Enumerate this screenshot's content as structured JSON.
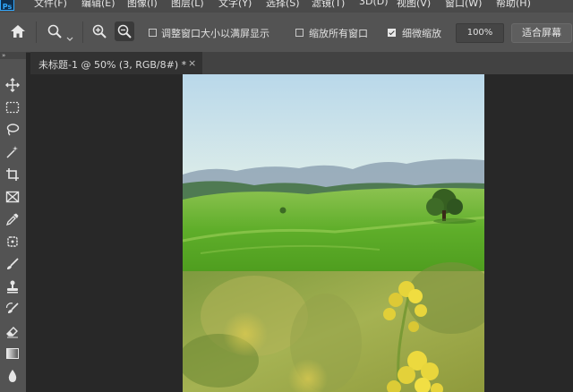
{
  "app": {
    "logo": "Ps"
  },
  "menu": [
    "文件(F)",
    "编辑(E)",
    "图像(I)",
    "图层(L)",
    "文字(Y)",
    "选择(S)",
    "滤镜(T)",
    "3D(D)",
    "视图(V)",
    "窗口(W)",
    "帮助(H)"
  ],
  "options": {
    "resize_windows_label": "调整窗口大小以满屏显示",
    "resize_windows_checked": false,
    "zoom_all_label": "缩放所有窗口",
    "zoom_all_checked": false,
    "scrubby_zoom_label": "细微缩放",
    "scrubby_zoom_checked": true,
    "zoom_value": "100%",
    "fit_screen_label": "适合屏幕"
  },
  "document": {
    "tab_title": "未标题-1 @ 50% (3, RGB/8#) *",
    "close_glyph": "×"
  },
  "toolbar": {
    "grip": "»",
    "tools": [
      "move-tool-icon",
      "marquee-tool-icon",
      "lasso-tool-icon",
      "magic-wand-tool-icon",
      "crop-tool-icon",
      "frame-tool-icon",
      "eyedropper-tool-icon",
      "healing-brush-tool-icon",
      "brush-tool-icon",
      "clone-stamp-tool-icon",
      "history-brush-tool-icon",
      "eraser-tool-icon",
      "gradient-tool-icon",
      "blur-tool-icon"
    ]
  },
  "colors": {
    "menubar": "#4a4a4a",
    "optionsbar": "#535353",
    "workspace": "#282828",
    "ps_blue": "#31a8ff"
  }
}
